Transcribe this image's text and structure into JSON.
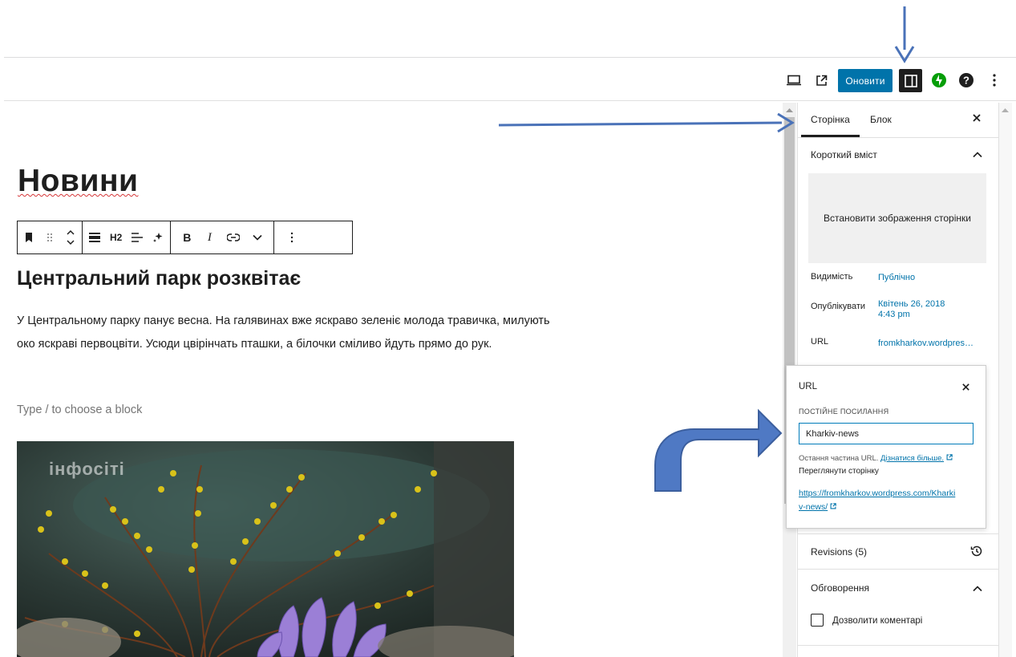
{
  "header": {
    "update_label": "Оновити",
    "icons": [
      "desktop-preview-icon",
      "external-link-icon",
      "sidebar-toggle-icon",
      "jetpack-icon",
      "help-icon",
      "more-vertical-icon"
    ]
  },
  "editor": {
    "title": "Новини",
    "toolbar": {
      "heading_level": "H2",
      "bold_label": "B",
      "italic_label": "I"
    },
    "heading": "Центральний парк розквітає",
    "paragraph": "У Центральному парку панує весна. На галявинах вже яскраво зеленіє молода травичка, милують око яскраві первоцвіти. Усюди цвірінчать пташки, а білочки сміливо йдуть прямо до рук.",
    "placeholder": "Type / to choose a block",
    "image_watermark": "інфосіті"
  },
  "sidebar": {
    "tabs": [
      "Сторінка",
      "Блок"
    ],
    "summary_title": "Короткий вміст",
    "featured_image_label": "Встановити зображення сторінки",
    "visibility_label": "Видимість",
    "visibility_value": "Публічно",
    "publish_label": "Опублікувати",
    "publish_date": "Квітень 26, 2018",
    "publish_time": "4:43 pm",
    "url_label": "URL",
    "url_value": "fromkharkov.wordpress.com/kharkiv-news",
    "revisions_label": "Revisions (5)",
    "discussion_title": "Обговорення",
    "allow_comments_label": "Дозволити коментарі"
  },
  "url_popover": {
    "title": "URL",
    "permalink_label": "ПОСТІЙНЕ ПОСИЛАННЯ",
    "slug_value": "Kharkiv-news",
    "help_text": "Остання частина URL.",
    "learn_more": "Дізнатися більше.",
    "view_page": "Переглянути сторінку",
    "full_url_line1": "https://fromkharkov.wordpress.com/Kharki",
    "full_url_line2": "v-news/"
  },
  "colors": {
    "accent": "#0073aa",
    "annotation_arrow": "#4a72b8"
  }
}
